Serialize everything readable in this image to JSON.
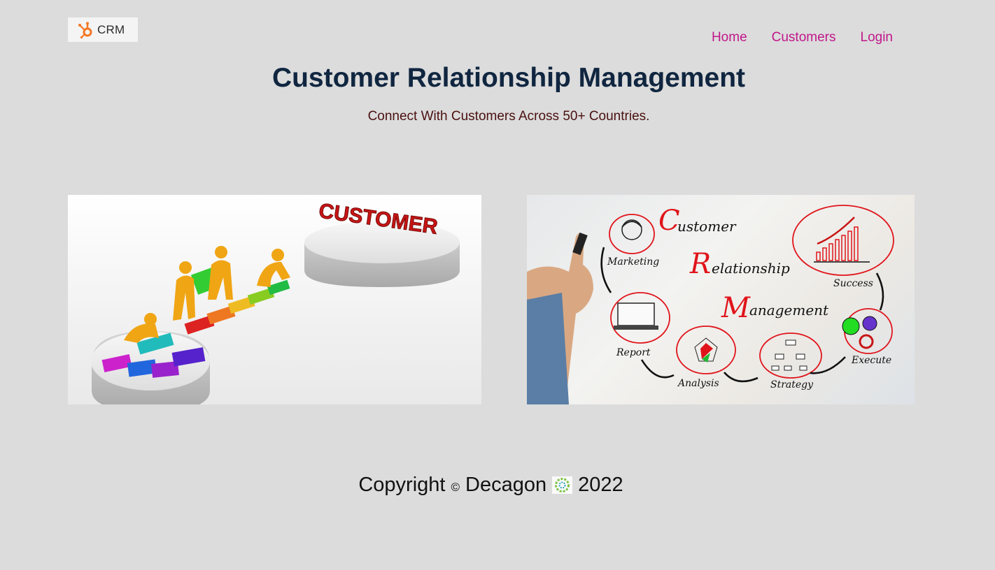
{
  "brand": {
    "logo_text": "CRM"
  },
  "nav": {
    "items": [
      "Home",
      "Customers",
      "Login"
    ]
  },
  "hero": {
    "title": "Customer Relationship Management",
    "subtitle": "Connect With Customers Across 50+ Countries."
  },
  "images": {
    "left": {
      "text": "CUSTOMER"
    },
    "right": {
      "heading_words": [
        {
          "initial": "C",
          "rest": "ustomer"
        },
        {
          "initial": "R",
          "rest": "elationship"
        },
        {
          "initial": "M",
          "rest": "anagement"
        }
      ],
      "steps": [
        "Marketing",
        "Report",
        "Analysis",
        "Strategy",
        "Execute",
        "Success"
      ]
    }
  },
  "footer": {
    "prefix": "Copyright",
    "symbol": "©",
    "company": "Decagon",
    "year": "2022"
  },
  "colors": {
    "background": "#dcdcdc",
    "nav_link": "#c0178a",
    "title": "#102640",
    "subtitle": "#4a1010",
    "logo_accent": "#f57722",
    "crm_red": "#e0141b"
  }
}
